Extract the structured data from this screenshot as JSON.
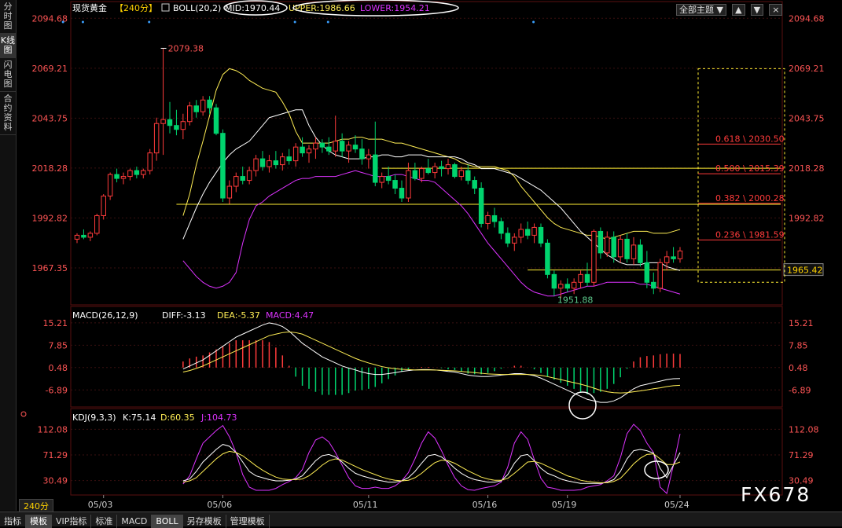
{
  "sidebar": {
    "items": [
      {
        "label": "分时图",
        "active": false
      },
      {
        "label": "K线图",
        "active": true
      },
      {
        "label": "闪电图",
        "active": false
      },
      {
        "label": "合约资料",
        "active": false
      }
    ]
  },
  "header": {
    "instrument": "现货黄金",
    "period": "【240分】",
    "boll_label": "BOLL(20,2)",
    "mid": "MID:1970.44",
    "upper": "UPPER:1986.66",
    "lower": "LOWER:1954.21"
  },
  "toolbar": {
    "theme_label": "全部主题",
    "dropdown_glyph": "▼",
    "up_glyph": "▲",
    "down_glyph": "▼",
    "close_glyph": "×"
  },
  "bottom_tabs": [
    {
      "label": "指标",
      "active": false
    },
    {
      "label": "模板",
      "active": true
    },
    {
      "label": "VIP指标",
      "active": false
    },
    {
      "label": "标准",
      "active": false
    },
    {
      "label": "MACD",
      "active": false
    },
    {
      "label": "BOLL",
      "active": true
    },
    {
      "label": "另存模板",
      "active": false
    },
    {
      "label": "管理模板",
      "active": false
    }
  ],
  "period_label": "240分",
  "watermark": "FX678",
  "colors": {
    "up": "#ff3b3b",
    "down": "#00d46e",
    "mid": "#ffffff",
    "upper": "#ffee55",
    "lower": "#dd33ff",
    "fib": "#ffee33",
    "axis_text": "#ff5555",
    "grid": "#3a1010"
  },
  "chart_data": [
    {
      "type": "candlestick",
      "panel": "price",
      "title": "",
      "xlabel": "",
      "ylabel": "",
      "x_ticks": [
        "05/03",
        "05/06",
        "05/11",
        "05/16",
        "05/19",
        "05/24"
      ],
      "y_ticks": [
        "2094.68",
        "2069.21",
        "2043.75",
        "2018.28",
        "1992.82",
        "1967.35"
      ],
      "ylim": [
        1950.5,
        2096
      ],
      "current_price": "1965.42",
      "annotations": {
        "high": "2079.38",
        "low": "1951.88"
      },
      "fibonacci": [
        {
          "label": "0.618 \\ 2030.50",
          "value": 2030.5
        },
        {
          "label": "0.500 \\ 2015.39",
          "value": 2015.39
        },
        {
          "label": "0.382 \\ 2000.28",
          "value": 2000.28
        },
        {
          "label": "0.236 \\ 1981.59",
          "value": 1981.59
        }
      ],
      "horizontal_lines": [
        2018.2,
        1999.8,
        1966.3
      ],
      "candles": [
        [
          1982,
          1985,
          1980,
          1984
        ],
        [
          1984,
          1987,
          1982,
          1983
        ],
        [
          1983,
          1986,
          1981,
          1985
        ],
        [
          1985,
          1995,
          1984,
          1994
        ],
        [
          1994,
          2005,
          1992,
          2004
        ],
        [
          2004,
          2016,
          2002,
          2015
        ],
        [
          2015,
          2018,
          2011,
          2013
        ],
        [
          2013,
          2016,
          2010,
          2014
        ],
        [
          2014,
          2018,
          2012,
          2017
        ],
        [
          2017,
          2019,
          2013,
          2015
        ],
        [
          2015,
          2018,
          2013,
          2017
        ],
        [
          2017,
          2028,
          2015,
          2026
        ],
        [
          2026,
          2044,
          2022,
          2041
        ],
        [
          2041,
          2079.38,
          2025,
          2043
        ],
        [
          2043,
          2052,
          2036,
          2040
        ],
        [
          2040,
          2048,
          2035,
          2038
        ],
        [
          2038,
          2046,
          2033,
          2042
        ],
        [
          2042,
          2052,
          2040,
          2050
        ],
        [
          2050,
          2053,
          2044,
          2047
        ],
        [
          2047,
          2055,
          2045,
          2053
        ],
        [
          2053,
          2055,
          2046,
          2049
        ],
        [
          2049,
          2051,
          2035,
          2036
        ],
        [
          2036,
          2038,
          2001,
          2003
        ],
        [
          2003,
          2012,
          2000,
          2009
        ],
        [
          2009,
          2016,
          2006,
          2014
        ],
        [
          2014,
          2019,
          2010,
          2012
        ],
        [
          2012,
          2019,
          2010,
          2017
        ],
        [
          2017,
          2025,
          2014,
          2023
        ],
        [
          2023,
          2027,
          2017,
          2019
        ],
        [
          2019,
          2025,
          2016,
          2022
        ],
        [
          2022,
          2027,
          2018,
          2020
        ],
        [
          2020,
          2026,
          2017,
          2024
        ],
        [
          2024,
          2028,
          2020,
          2022
        ],
        [
          2022,
          2031,
          2019,
          2029
        ],
        [
          2029,
          2034,
          2024,
          2026
        ],
        [
          2026,
          2030,
          2021,
          2028
        ],
        [
          2028,
          2034,
          2023,
          2031
        ],
        [
          2031,
          2033,
          2026,
          2029
        ],
        [
          2029,
          2034,
          2025,
          2027
        ],
        [
          2027,
          2045,
          2024,
          2032
        ],
        [
          2032,
          2036,
          2024,
          2027
        ],
        [
          2027,
          2032,
          2021,
          2030
        ],
        [
          2030,
          2035,
          2026,
          2028
        ],
        [
          2028,
          2033,
          2020,
          2023
        ],
        [
          2023,
          2028,
          2018,
          2025
        ],
        [
          2025,
          2042,
          2009,
          2011
        ],
        [
          2011,
          2016,
          2008,
          2014
        ],
        [
          2014,
          2019,
          2010,
          2012
        ],
        [
          2012,
          2015,
          2005,
          2008
        ],
        [
          2008,
          2012,
          2001,
          2003
        ],
        [
          2003,
          2021,
          2001,
          2017
        ],
        [
          2017,
          2021,
          2012,
          2013
        ],
        [
          2013,
          2019,
          2011,
          2018
        ],
        [
          2018,
          2023,
          2015,
          2016
        ],
        [
          2016,
          2021,
          2013,
          2019
        ],
        [
          2019,
          2022,
          2014,
          2018
        ],
        [
          2018,
          2023,
          2015,
          2020
        ],
        [
          2020,
          2021,
          2013,
          2014
        ],
        [
          2014,
          2019,
          2012,
          2017
        ],
        [
          2017,
          2020,
          2010,
          2012
        ],
        [
          2012,
          2014,
          2005,
          2008
        ],
        [
          2008,
          2011,
          1988,
          1990
        ],
        [
          1990,
          1996,
          1987,
          1994
        ],
        [
          1994,
          1998,
          1988,
          1991
        ],
        [
          1991,
          1993,
          1982,
          1985
        ],
        [
          1985,
          1988,
          1978,
          1980
        ],
        [
          1980,
          1985,
          1976,
          1983
        ],
        [
          1983,
          1990,
          1980,
          1987
        ],
        [
          1987,
          1991,
          1982,
          1984
        ],
        [
          1984,
          1990,
          1980,
          1988
        ],
        [
          1988,
          1990,
          1978,
          1980
        ],
        [
          1980,
          1982,
          1962,
          1964
        ],
        [
          1964,
          1966,
          1953,
          1957
        ],
        [
          1957,
          1961,
          1951.88,
          1959
        ],
        [
          1959,
          1962,
          1955,
          1957
        ],
        [
          1957,
          1962,
          1954,
          1960
        ],
        [
          1960,
          1966,
          1957,
          1964
        ],
        [
          1964,
          1970,
          1958,
          1960
        ],
        [
          1960,
          1987,
          1958,
          1986
        ],
        [
          1986,
          1988,
          1972,
          1975
        ],
        [
          1975,
          1986,
          1973,
          1983
        ],
        [
          1983,
          1986,
          1970,
          1973
        ],
        [
          1973,
          1984,
          1970,
          1982
        ],
        [
          1982,
          1985,
          1970,
          1972
        ],
        [
          1972,
          1983,
          1969,
          1979
        ],
        [
          1979,
          1982,
          1968,
          1970
        ],
        [
          1970,
          1976,
          1957,
          1960
        ],
        [
          1960,
          1965,
          1954,
          1957
        ],
        [
          1957,
          1972,
          1955,
          1970
        ],
        [
          1970,
          1976,
          1966,
          1973
        ],
        [
          1973,
          1978,
          1970,
          1972
        ],
        [
          1972,
          1978,
          1970,
          1976
        ]
      ],
      "mid": [
        1982,
        1990,
        1998,
        2005,
        2011,
        2016,
        2021,
        2025,
        2028,
        2030,
        2032,
        2036,
        2040,
        2044,
        2045,
        2046,
        2047,
        2048,
        2048,
        2040,
        2034,
        2030,
        2027,
        2025,
        2024,
        2023,
        2023,
        2023,
        2024,
        2024,
        2025,
        2025,
        2024,
        2024,
        2025,
        2025,
        2025,
        2024,
        2024,
        2024,
        2024,
        2024,
        2023,
        2021,
        2020,
        2018,
        2018,
        2018,
        2017,
        2016,
        2015,
        2013,
        2011,
        2009,
        2007,
        2004,
        2001,
        1998,
        1994,
        1990,
        1986,
        1983,
        1980,
        1977,
        1974,
        1972,
        1970,
        1969,
        1969,
        1969,
        1970,
        1970,
        1970,
        1968,
        1967,
        1966
      ],
      "upper": [
        1994,
        2005,
        2020,
        2032,
        2045,
        2058,
        2066,
        2069,
        2068,
        2066,
        2063,
        2061,
        2059,
        2058,
        2057,
        2052,
        2046,
        2037,
        2031,
        2031,
        2031,
        2031,
        2031,
        2032,
        2033,
        2033,
        2034,
        2034,
        2033,
        2033,
        2033,
        2032,
        2031,
        2031,
        2030,
        2029,
        2028,
        2027,
        2026,
        2025,
        2024,
        2023,
        2021,
        2020,
        2019,
        2019,
        2019,
        2019,
        2018,
        2017,
        2014,
        2009,
        2005,
        2001,
        1997,
        1993,
        1990,
        1988,
        1987,
        1986,
        1985,
        1984,
        1984,
        1983,
        1982,
        1983,
        1984,
        1985,
        1986,
        1986,
        1986,
        1985,
        1985,
        1985,
        1986,
        1987
      ],
      "lower": [
        1971,
        1967,
        1963,
        1960,
        1958,
        1957,
        1958,
        1960,
        1965,
        1980,
        1992,
        1999,
        2001,
        2004,
        2006,
        2008,
        2010,
        2012,
        2013,
        2013,
        2014,
        2014,
        2014,
        2014,
        2015,
        2016,
        2017,
        2016,
        2015,
        2014,
        2014,
        2014,
        2015,
        2015,
        2014,
        2013,
        2012,
        2012,
        2011,
        2008,
        2005,
        2002,
        1999,
        1995,
        1990,
        1985,
        1980,
        1976,
        1972,
        1968,
        1964,
        1960,
        1957,
        1955,
        1954,
        1953,
        1953,
        1954,
        1955,
        1956,
        1957,
        1958,
        1958,
        1959,
        1960,
        1960,
        1960,
        1960,
        1960,
        1959,
        1959,
        1958,
        1957,
        1956,
        1955,
        1954
      ]
    },
    {
      "type": "bar",
      "panel": "macd",
      "title": "MACD(26,12,9)",
      "legend": {
        "diff": "DIFF:-3.13",
        "dea": "DEA:-5.37",
        "macd": "MACD:4.47"
      },
      "y_ticks": [
        "15.21",
        "7.85",
        "0.48",
        "-6.89"
      ],
      "ylim": [
        -12,
        17
      ],
      "diff": [
        0,
        1,
        2,
        3,
        4.5,
        6,
        7.5,
        9,
        10.5,
        11.5,
        12.5,
        13.5,
        14.5,
        15.2,
        14.8,
        14,
        12.5,
        10.5,
        8.5,
        7,
        5.5,
        4,
        3,
        2,
        1,
        0.3,
        -0.3,
        -1,
        -1.5,
        -1.8,
        -1.8,
        -1.5,
        -1.2,
        -0.8,
        -0.5,
        -0.3,
        -0.2,
        -0.2,
        -0.3,
        -0.5,
        -0.8,
        -1,
        -1.5,
        -2,
        -2.3,
        -2.5,
        -2.5,
        -2.3,
        -2,
        -1.8,
        -1.5,
        -1.5,
        -1.8,
        -2.2,
        -3,
        -4,
        -5,
        -6,
        -7,
        -8,
        -9,
        -10,
        -10.5,
        -11,
        -11,
        -10.5,
        -9.5,
        -8,
        -6.5,
        -5.5,
        -5,
        -4.5,
        -4,
        -3.5,
        -3.2,
        -3.13
      ],
      "dea": [
        -1,
        -0.5,
        0.2,
        1,
        2,
        3,
        4,
        5,
        6,
        7,
        8,
        9,
        10,
        11,
        11.5,
        12,
        12.2,
        12,
        11.5,
        10.5,
        9.5,
        8.5,
        7.5,
        6.5,
        5.5,
        4.5,
        3.5,
        2.7,
        2,
        1.4,
        0.8,
        0.4,
        0.1,
        -0.1,
        -0.2,
        -0.3,
        -0.3,
        -0.3,
        -0.3,
        -0.4,
        -0.5,
        -0.6,
        -0.8,
        -1,
        -1.2,
        -1.4,
        -1.6,
        -1.7,
        -1.8,
        -1.8,
        -1.8,
        -1.8,
        -1.8,
        -1.9,
        -2.1,
        -2.5,
        -3,
        -3.5,
        -4,
        -4.5,
        -5,
        -5.6,
        -6.3,
        -7,
        -7.5,
        -7.8,
        -7.9,
        -7.8,
        -7.5,
        -7.2,
        -6.9,
        -6.5,
        -6.2,
        -5.8,
        -5.5,
        -5.37
      ]
    },
    {
      "type": "line",
      "panel": "kdj",
      "title": "KDJ(9,3,3)",
      "legend": {
        "k": "K:75.14",
        "d": "D:60.35",
        "j": "J:104.73"
      },
      "y_ticks": [
        "112.08",
        "71.29",
        "30.49"
      ],
      "ylim": [
        10,
        120
      ],
      "k": [
        30,
        33,
        45,
        60,
        70,
        80,
        88,
        85,
        75,
        60,
        45,
        38,
        35,
        32,
        30,
        30,
        31,
        33,
        38,
        50,
        62,
        70,
        72,
        68,
        60,
        50,
        42,
        38,
        35,
        32,
        30,
        28,
        28,
        30,
        35,
        45,
        58,
        70,
        72,
        68,
        60,
        50,
        42,
        36,
        32,
        30,
        28,
        28,
        30,
        40,
        58,
        70,
        72,
        62,
        50,
        42,
        38,
        33,
        30,
        28,
        26,
        26,
        26,
        26,
        28,
        32,
        45,
        65,
        78,
        80,
        78,
        74,
        50,
        35,
        55,
        75
      ],
      "d": [
        28,
        30,
        35,
        45,
        55,
        65,
        73,
        77,
        75,
        70,
        62,
        54,
        47,
        41,
        36,
        33,
        32,
        32,
        33,
        38,
        46,
        55,
        62,
        65,
        63,
        58,
        53,
        48,
        44,
        40,
        36,
        33,
        31,
        30,
        31,
        35,
        42,
        51,
        59,
        63,
        62,
        58,
        52,
        46,
        41,
        36,
        33,
        31,
        31,
        34,
        42,
        51,
        60,
        61,
        58,
        53,
        48,
        43,
        38,
        35,
        31,
        29,
        28,
        27,
        27,
        29,
        34,
        45,
        57,
        66,
        72,
        73,
        65,
        56,
        56,
        60
      ],
      "j": [
        25,
        38,
        65,
        90,
        100,
        110,
        118,
        100,
        75,
        40,
        20,
        15,
        15,
        15,
        18,
        24,
        29,
        35,
        48,
        75,
        95,
        100,
        92,
        75,
        55,
        35,
        22,
        18,
        18,
        20,
        18,
        18,
        22,
        30,
        43,
        65,
        90,
        108,
        98,
        78,
        55,
        35,
        22,
        16,
        15,
        18,
        20,
        22,
        28,
        52,
        90,
        108,
        96,
        64,
        34,
        20,
        18,
        15,
        15,
        15,
        16,
        20,
        22,
        24,
        30,
        38,
        67,
        105,
        120,
        110,
        90,
        75,
        20,
        10,
        55,
        104.73
      ]
    }
  ]
}
